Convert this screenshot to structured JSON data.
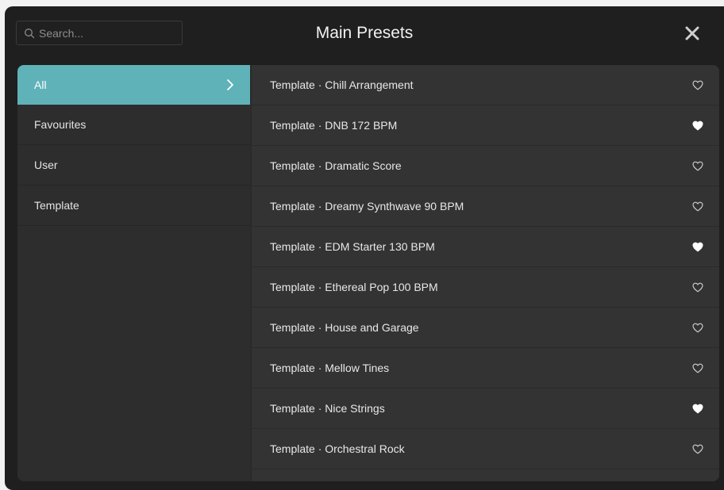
{
  "header": {
    "title": "Main Presets",
    "search": {
      "placeholder": "Search...",
      "value": ""
    },
    "close_icon": "close-icon"
  },
  "categories": [
    {
      "label": "All",
      "active": true
    },
    {
      "label": "Favourites",
      "active": false
    },
    {
      "label": "User",
      "active": false
    },
    {
      "label": "Template",
      "active": false
    }
  ],
  "presets": [
    {
      "label": "Template · Chill Arrangement",
      "favourite": false
    },
    {
      "label": "Template · DNB 172 BPM",
      "favourite": true
    },
    {
      "label": "Template · Dramatic Score",
      "favourite": false
    },
    {
      "label": "Template · Dreamy Synthwave 90 BPM",
      "favourite": false
    },
    {
      "label": "Template · EDM Starter 130 BPM",
      "favourite": true
    },
    {
      "label": "Template · Ethereal Pop 100 BPM",
      "favourite": false
    },
    {
      "label": "Template · House and Garage",
      "favourite": false
    },
    {
      "label": "Template · Mellow Tines",
      "favourite": false
    },
    {
      "label": "Template · Nice Strings",
      "favourite": true
    },
    {
      "label": "Template · Orchestral Rock",
      "favourite": false
    }
  ],
  "colors": {
    "accent": "#5fb2b7",
    "window_bg": "#1f1f1f",
    "list_bg": "#333333",
    "sidebar_bg": "#2d2d2d"
  }
}
